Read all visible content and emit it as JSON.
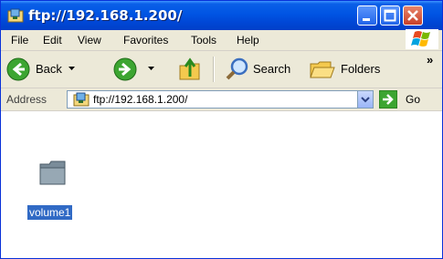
{
  "window": {
    "title": "ftp://192.168.1.200/"
  },
  "menu": {
    "items": [
      "File",
      "Edit",
      "View",
      "Favorites",
      "Tools",
      "Help"
    ]
  },
  "toolbar": {
    "back_label": "Back",
    "search_label": "Search",
    "folders_label": "Folders",
    "overflow": "»"
  },
  "address": {
    "label": "Address",
    "value": "ftp://192.168.1.200/",
    "go_label": "Go"
  },
  "content": {
    "items": [
      {
        "name": "volume1",
        "type": "folder"
      }
    ]
  },
  "colors": {
    "title_bar": "#0054e3",
    "selection": "#316ac5",
    "window_bg": "#ece9d8"
  }
}
